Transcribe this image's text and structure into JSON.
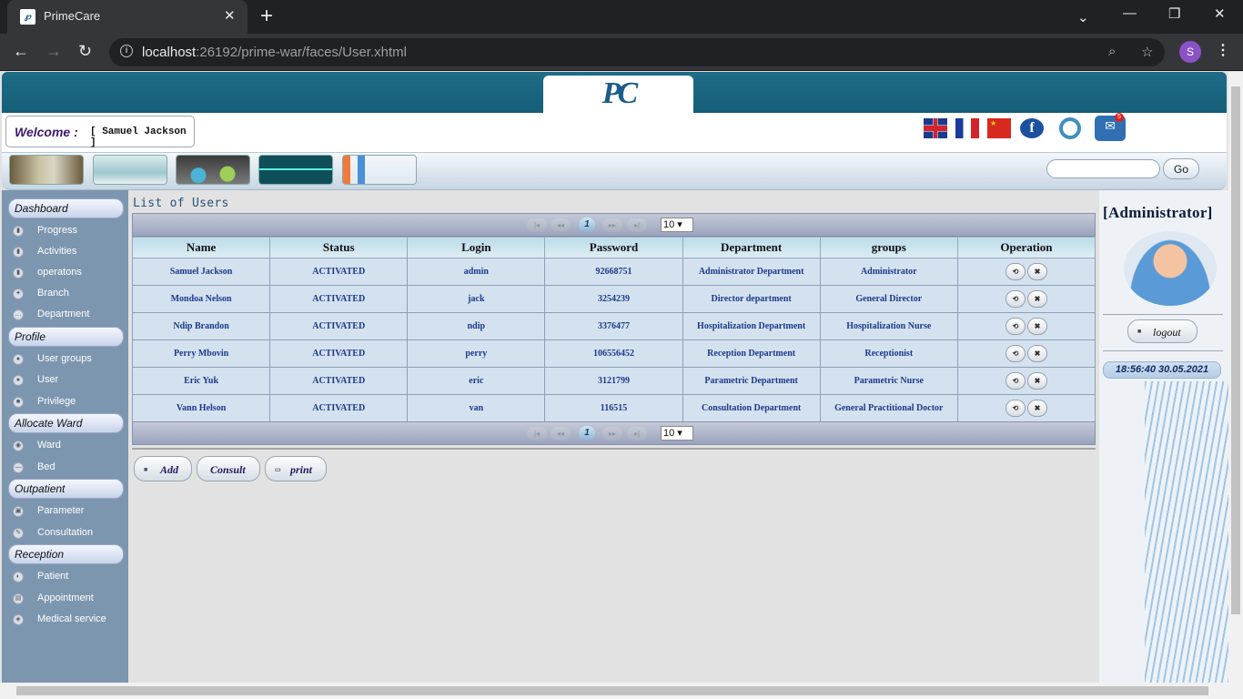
{
  "browser": {
    "tab_title": "PrimeCare",
    "url_host": "localhost",
    "url_rest": ":26192/prime-war/faces/User.xhtml",
    "profile_initial": "S"
  },
  "header": {
    "logo_text": "PC",
    "welcome_label": "Welcome :",
    "welcome_user": "[ Samuel Jackson ]",
    "search_placeholder": "",
    "go_label": "Go"
  },
  "sidebar": {
    "sections": [
      {
        "title": "Dashboard",
        "items": [
          "Progress",
          "Activities",
          "operatons",
          "Branch",
          "Department"
        ]
      },
      {
        "title": "Profile",
        "items": [
          "User groups",
          "User",
          "Privilege"
        ]
      },
      {
        "title": "Allocate Ward",
        "items": [
          "Ward",
          "Bed"
        ]
      },
      {
        "title": "Outpatient",
        "items": [
          "Parameter",
          "Consultation"
        ]
      },
      {
        "title": "Reception",
        "items": [
          "Patient",
          "Appointment",
          "Medical service"
        ]
      }
    ]
  },
  "main": {
    "title": "List of Users",
    "paginator": {
      "current_page": "1",
      "rows_per_page": "10"
    },
    "columns": [
      "Name",
      "Status",
      "Login",
      "Password",
      "Department",
      "groups",
      "Operation"
    ],
    "rows": [
      [
        "Samuel Jackson",
        "ACTIVATED",
        "admin",
        "92668751",
        "Administrator Department",
        "Administrator"
      ],
      [
        "Mondoa Nelson",
        "ACTIVATED",
        "jack",
        "3254239",
        "Director department",
        "General Director"
      ],
      [
        "Ndip Brandon",
        "ACTIVATED",
        "ndip",
        "3376477",
        "Hospitalization Department",
        "Hospitalization Nurse"
      ],
      [
        "Perry Mbovin",
        "ACTIVATED",
        "perry",
        "106556452",
        "Reception Department",
        "Receptionist"
      ],
      [
        "Eric Yuk",
        "ACTIVATED",
        "eric",
        "3121799",
        "Parametric Department",
        "Parametric Nurse"
      ],
      [
        "Vann Helson",
        "ACTIVATED",
        "van",
        "116515",
        "Consultation Department",
        "General Practitional Doctor"
      ]
    ],
    "actions": {
      "add": "Add",
      "consult": "Consult",
      "print": "print"
    }
  },
  "right_panel": {
    "role": "[Administrator]",
    "logout_label": "logout",
    "clock": "18:56:40 30.05.2021"
  },
  "colors": {
    "banner": "#1e6c86",
    "sidebar": "#7d96b0",
    "table_cell": "#d4e1ef",
    "cell_text": "#1b3a8a"
  }
}
